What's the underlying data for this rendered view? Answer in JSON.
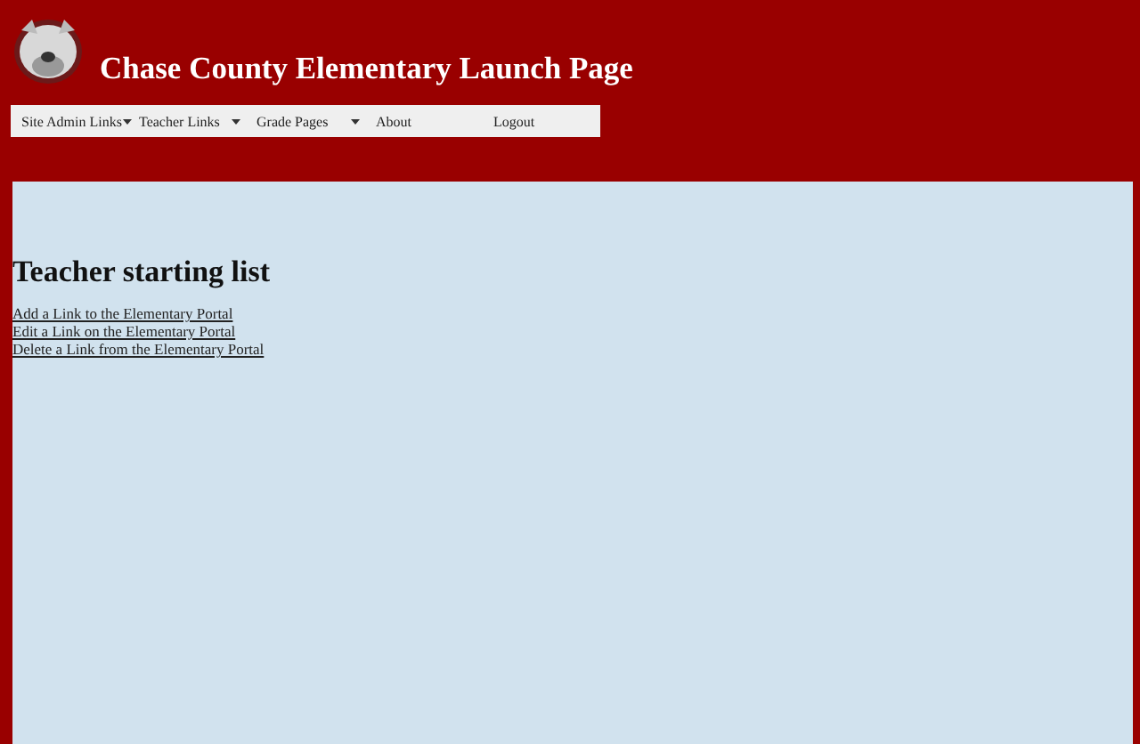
{
  "header": {
    "title": "Chase County Elementary Launch Page"
  },
  "menu": [
    {
      "label": "Site Admin Links",
      "dropdown": true
    },
    {
      "label": "Teacher Links",
      "dropdown": true
    },
    {
      "label": "Grade Pages",
      "dropdown": true
    },
    {
      "label": "About",
      "dropdown": false
    },
    {
      "label": "Logout",
      "dropdown": false
    }
  ],
  "content": {
    "heading": "Teacher starting list",
    "links": [
      "Add a Link to the Elementary Portal",
      "Edit a Link on the Elementary Portal",
      "Delete a Link from the Elementary Portal"
    ]
  }
}
